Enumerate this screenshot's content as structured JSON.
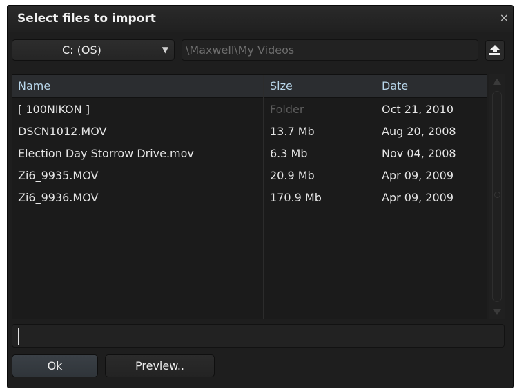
{
  "dialog": {
    "title": "Select files to import",
    "close_label": "×"
  },
  "drive": {
    "selected": "C: (OS)",
    "arrow": "▼"
  },
  "path": {
    "value": "\\Maxwell\\My Videos"
  },
  "columns": {
    "name": "Name",
    "size": "Size",
    "date": "Date"
  },
  "files": [
    {
      "name": "[ 100NIKON ]",
      "size": "Folder",
      "date": "Oct 21, 2010"
    },
    {
      "name": "DSCN1012.MOV",
      "size": "13.7 Mb",
      "date": "Aug 20, 2008"
    },
    {
      "name": "Election Day Storrow Drive.mov",
      "size": "6.3 Mb",
      "date": "Nov 04, 2008"
    },
    {
      "name": "Zi6_9935.MOV",
      "size": "20.9 Mb",
      "date": "Apr 09, 2009"
    },
    {
      "name": "Zi6_9936.MOV",
      "size": "170.9 Mb",
      "date": "Apr 09, 2009"
    }
  ],
  "filename_field": {
    "value": ""
  },
  "buttons": {
    "ok": "Ok",
    "preview": "Preview.."
  },
  "icons": {
    "up": "up-folder-icon",
    "close": "close-icon",
    "dropdown": "chevron-down-icon"
  },
  "colors": {
    "background": "#1e1e1e",
    "header_text": "#b8d6ea",
    "text": "#e6e6e6",
    "dim_text": "#5c5c5c",
    "ok_button": "#353a3f"
  }
}
